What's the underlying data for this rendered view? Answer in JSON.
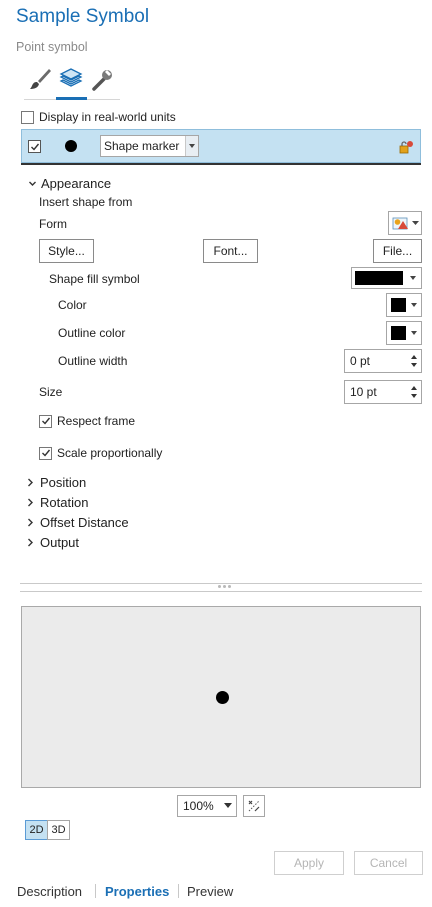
{
  "header": {
    "title": "Sample Symbol",
    "subtitle": "Point symbol"
  },
  "tabs": [
    {
      "icon": "paintbrush-icon",
      "active": false
    },
    {
      "icon": "layers-icon",
      "active": true
    },
    {
      "icon": "wrench-icon",
      "active": false
    }
  ],
  "real_world": {
    "label": "Display in real-world units",
    "checked": false
  },
  "layer": {
    "checked": true,
    "type_value": "Shape marker"
  },
  "appearance": {
    "title": "Appearance",
    "insert_label": "Insert shape from",
    "form_label": "Form",
    "style_button": "Style...",
    "font_button": "Font...",
    "file_button": "File...",
    "fill_label": "Shape fill symbol",
    "color_label": "Color",
    "outline_color_label": "Outline color",
    "outline_width_label": "Outline width",
    "outline_width_value": "0 pt",
    "size_label": "Size",
    "size_value": "10 pt",
    "respect_frame": {
      "label": "Respect frame",
      "checked": true
    },
    "scale_prop": {
      "label": "Scale proportionally",
      "checked": true
    },
    "fill_color": "#000000"
  },
  "sections": [
    "Position",
    "Rotation",
    "Offset Distance",
    "Output"
  ],
  "preview": {
    "zoom": "100%",
    "mode_2d": "2D",
    "mode_3d": "3D",
    "active_mode": "2D"
  },
  "actions": {
    "apply": "Apply",
    "cancel": "Cancel"
  },
  "bottom_tabs": [
    {
      "label": "Description",
      "active": false
    },
    {
      "label": "Properties",
      "active": true
    },
    {
      "label": "Preview",
      "active": false
    }
  ],
  "colors": {
    "accent": "#1a6fb5",
    "selected_row": "#c4e1f2"
  }
}
